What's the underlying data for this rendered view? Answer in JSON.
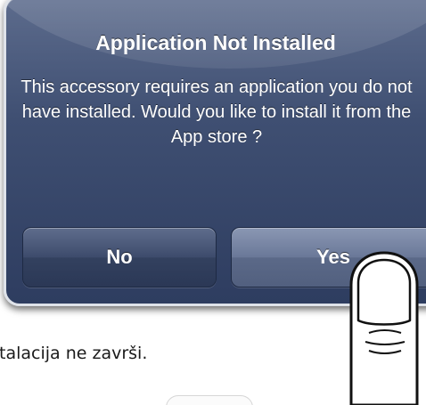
{
  "alert": {
    "title": "Application Not Installed",
    "message": "This accessory requires an application you do not have installed. Would you like to install it from the App store ?",
    "buttons": {
      "no_label": "No",
      "yes_label": "Yes"
    }
  },
  "caption": "talacija ne završi.",
  "icons": {
    "finger": "finger-pointer-icon"
  },
  "colors": {
    "alert_background": "#3f4f72",
    "alert_border": "#dfe3ea",
    "button_dark": "#2b3856",
    "button_highlighted": "#6a7898"
  }
}
